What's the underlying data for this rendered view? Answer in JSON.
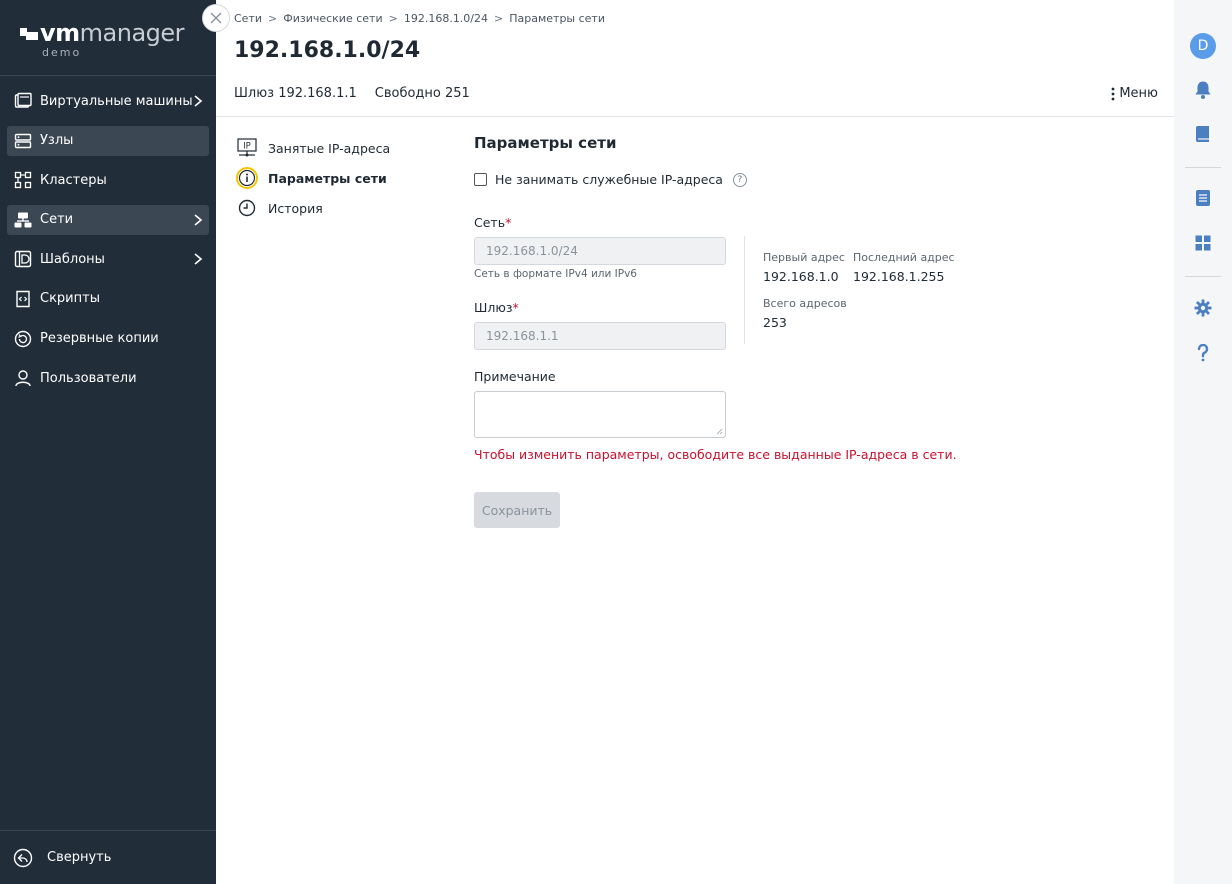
{
  "logo": {
    "vm": "vm",
    "manager": "manager",
    "sub": "demo"
  },
  "sidebar": {
    "items": [
      {
        "label": "Виртуальные машины",
        "icon": "vm-icon"
      },
      {
        "label": "Узлы",
        "icon": "nodes-icon"
      },
      {
        "label": "Кластеры",
        "icon": "clusters-icon"
      },
      {
        "label": "Сети",
        "icon": "networks-icon"
      },
      {
        "label": "Шаблоны",
        "icon": "templates-icon"
      },
      {
        "label": "Скрипты",
        "icon": "scripts-icon"
      },
      {
        "label": "Резервные копии",
        "icon": "backup-icon"
      },
      {
        "label": "Пользователи",
        "icon": "users-icon"
      }
    ],
    "collapse_label": "Свернуть"
  },
  "breadcrumb": [
    "Сети",
    "Физические сети",
    "192.168.1.0/24",
    "Параметры сети"
  ],
  "breadcrumb_sep": ">",
  "header": {
    "title": "192.168.1.0/24",
    "gateway": "Шлюз 192.168.1.1",
    "free": "Свободно 251",
    "menu_label": "Меню"
  },
  "subnav": {
    "items": [
      {
        "label": "Занятые IP-адреса"
      },
      {
        "label": "Параметры сети"
      },
      {
        "label": "История"
      }
    ],
    "ip_badge": "IP"
  },
  "form": {
    "title": "Параметры сети",
    "checkbox_label": "Не занимать служебные IP-адреса",
    "help": "?",
    "network_label": "Сеть",
    "required_mark": "*",
    "network_value": "192.168.1.0/24",
    "network_hint": "Сеть в формате IPv4 или IPv6",
    "gateway_label": "Шлюз",
    "gateway_value": "192.168.1.1",
    "note_label": "Примечание",
    "warning": "Чтобы изменить параметры, освободите все выданные IP-адреса в сети.",
    "save_label": "Сохранить"
  },
  "info": {
    "first_label": "Первый адрес",
    "first_value": "192.168.1.0",
    "last_label": "Последний адрес",
    "last_value": "192.168.1.255",
    "total_label": "Всего адресов",
    "total_value": "253"
  },
  "rail": {
    "avatar": "D"
  },
  "colors": {
    "sidebar_bg": "#222d3a",
    "accent": "#5a9bea",
    "warning": "#c8102e",
    "active_ring": "#f5c400"
  }
}
